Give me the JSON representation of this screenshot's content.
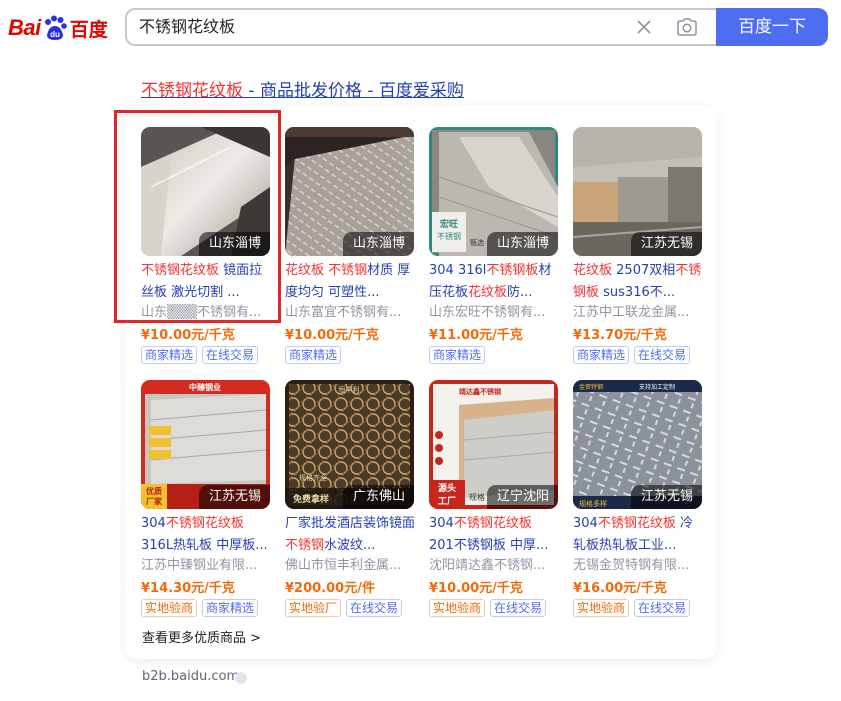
{
  "logo": {
    "latin": "Bai",
    "du": "du",
    "cn": "百度"
  },
  "search": {
    "query": "不锈钢花纹板",
    "button_label": "百度一下"
  },
  "result": {
    "title_highlight": "不锈钢花纹板",
    "title_rest": " - 商品批发价格 - 百度爱采购",
    "more_link": "查看更多优质商品 >",
    "source": "b2b.baidu.com"
  },
  "products": [
    {
      "location": "山东淄博",
      "name_hl1": "不锈钢花纹板",
      "name_rest": " 镜面拉丝板 激光切割 ...",
      "seller": "山东▒▒▒不锈钢有...",
      "price": "¥10.00元/千克",
      "tags": [
        "商家精选",
        "在线交易"
      ],
      "tag_colors": [
        "blue",
        "blue"
      ]
    },
    {
      "location": "山东淄博",
      "name_hl1": "花纹板 ",
      "name_hl2": "不锈钢",
      "name_rest": "材质 厚度均匀 可塑性...",
      "seller": "山东富宜不锈钢有...",
      "price": "¥10.00元/千克",
      "tags": [
        "商家精选"
      ],
      "tag_colors": [
        "blue"
      ]
    },
    {
      "location": "山东淄博",
      "name_pre": "304 316l",
      "name_hl1": "不锈钢板",
      "name_rest": "材压花板",
      "name_hl2": "花纹板",
      "name_tail": "防...",
      "seller": "山东宏旺不锈钢有...",
      "price": "¥11.00元/千克",
      "tags": [
        "商家精选"
      ],
      "tag_colors": [
        "blue"
      ]
    },
    {
      "location": "江苏无锡",
      "name_hl1": "花纹板",
      "name_rest": " 2507双相",
      "name_hl2": "不锈钢板",
      "name_tail": " sus316不...",
      "seller": "江苏中工联龙金属...",
      "price": "¥13.70元/千克",
      "tags": [
        "商家精选",
        "在线交易"
      ],
      "tag_colors": [
        "blue",
        "blue"
      ]
    },
    {
      "location": "江苏无锡",
      "name_pre": "304",
      "name_hl1": "不锈钢花纹板",
      "name_rest": " 316L热轧板 中厚板...",
      "seller": "江苏中臻钢业有限...",
      "price": "¥14.30元/千克",
      "tags": [
        "实地验商",
        "商家精选"
      ],
      "tag_colors": [
        "orange",
        "blue"
      ]
    },
    {
      "location": "广东佛山",
      "name_pre": "厂家批发酒店装饰镜面 ",
      "name_hl1": "不锈钢",
      "name_rest": "水波纹...",
      "seller": "佛山市恒丰利金属...",
      "price": "¥200.00元/件",
      "tags": [
        "实地验厂",
        "在线交易"
      ],
      "tag_colors": [
        "orange",
        "blue"
      ]
    },
    {
      "location": "辽宁沈阳",
      "name_pre": "304",
      "name_hl1": "不锈钢花纹板",
      "name_rest": " 201不锈钢板 中厚...",
      "seller": "沈阳靖达鑫不锈钢...",
      "price": "¥10.00元/千克",
      "tags": [
        "实地验商",
        "在线交易"
      ],
      "tag_colors": [
        "orange",
        "blue"
      ]
    },
    {
      "location": "江苏无锡",
      "name_pre": "304",
      "name_hl1": "不锈钢花纹板",
      "name_rest": " 冷轧板热轧板工业...",
      "seller": "无锡金贺特钢有限...",
      "price": "¥16.00元/千克",
      "tags": [
        "实地验商",
        "在线交易"
      ],
      "tag_colors": [
        "orange",
        "blue"
      ]
    }
  ],
  "thumb_texts": {
    "p3_brand": "宏旺",
    "p3_brand2": "不锈钢",
    "p3_brand3": "甄选",
    "p5_banner": "中臻钢业",
    "p5_side1": "优质",
    "p5_side2": "厂家",
    "p6_top": "恒丰利",
    "p6_side": "规格齐全",
    "p6_bottom": "免费拿样",
    "p7_top": "靖达鑫不锈钢",
    "p7_side": "源头",
    "p7_side2": "工厂",
    "p7_bottom": "规格",
    "p8_top": "金贺特钢",
    "p8_top2": "支持加工定制",
    "p8_bottom": "规格多样"
  },
  "colors": {
    "brand_red": "#e10601",
    "link_blue": "#2440b3",
    "highlight_red": "#f73131",
    "price_orange": "#f26a0b",
    "button_blue": "#4e6ef2"
  },
  "icons": [
    "baidu-paw-icon",
    "clear-icon",
    "camera-icon",
    "source-info-icon"
  ]
}
